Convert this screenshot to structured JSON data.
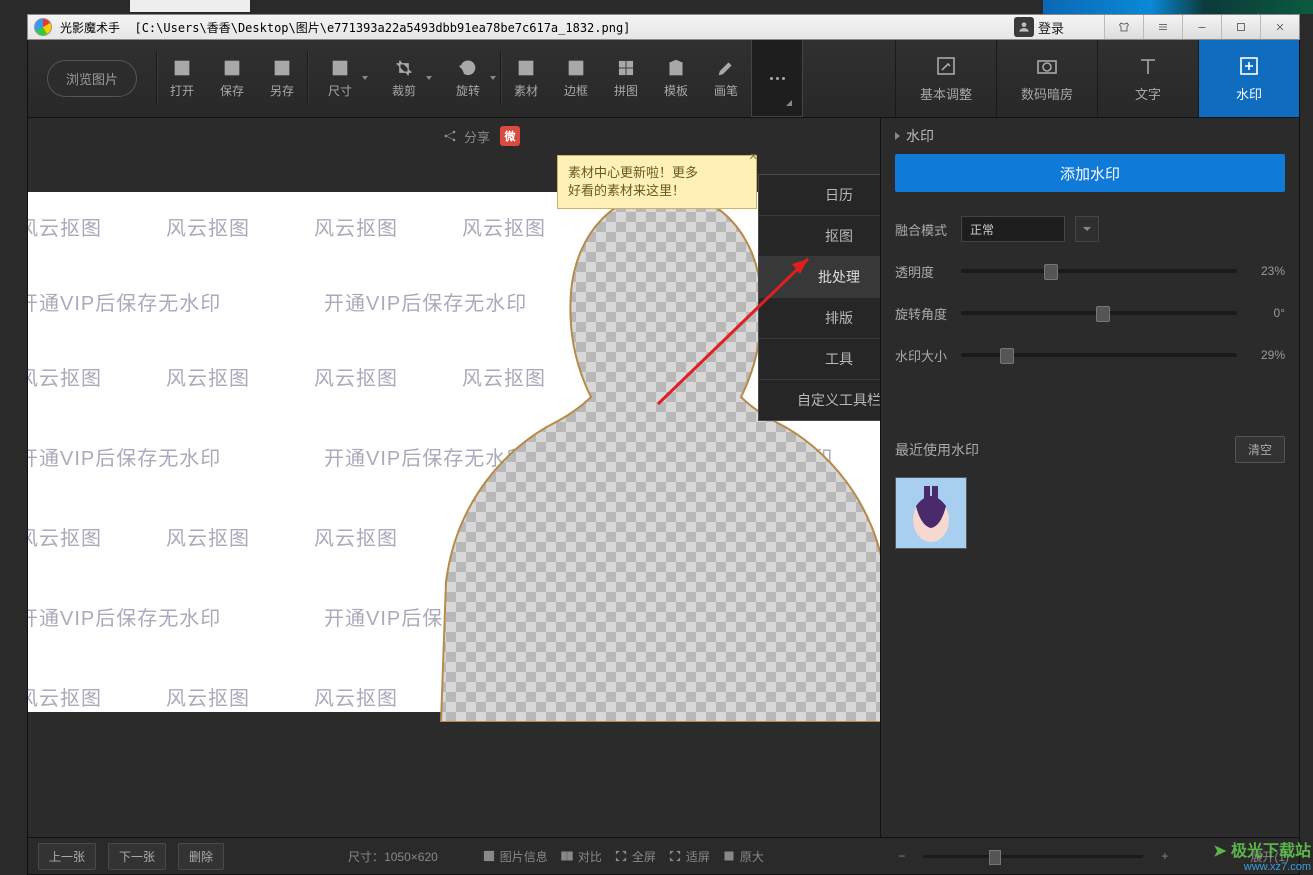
{
  "titlebar": {
    "app_name": "光影魔术手",
    "file_path": "[C:\\Users\\香香\\Desktop\\图片\\e771393a22a5493dbb91ea78be7c617a_1832.png]",
    "login": "登录"
  },
  "toolbar": {
    "browse": "浏览图片",
    "open": "打开",
    "save": "保存",
    "saveas": "另存",
    "size": "尺寸",
    "crop": "裁剪",
    "rotate": "旋转",
    "material": "素材",
    "border": "边框",
    "collage": "拼图",
    "template": "模板",
    "brush": "画笔",
    "tabs": {
      "basic": "基本调整",
      "darkroom": "数码暗房",
      "text": "文字",
      "watermark": "水印"
    }
  },
  "share_label": "分享",
  "tooltip": {
    "line1": "素材中心更新啦！更多",
    "line2": "好看的素材来这里！"
  },
  "dropdown": {
    "items": [
      "日历",
      "抠图",
      "批处理",
      "排版",
      "工具",
      "自定义工具栏"
    ]
  },
  "watermark_overlay": {
    "a": "风云抠图",
    "b": "开通VIP后保存无水印"
  },
  "side": {
    "title": "水印",
    "add": "添加水印",
    "blend_label": "融合模式",
    "blend_value": "正常",
    "opacity_label": "透明度",
    "opacity_value": "23%",
    "rotation_label": "旋转角度",
    "rotation_value": "0°",
    "size_label": "水印大小",
    "size_value": "29%",
    "recent_label": "最近使用水印",
    "clear": "清空"
  },
  "footer": {
    "prev": "上一张",
    "next": "下一张",
    "delete": "删除",
    "dim_label": "尺寸：",
    "dim_value": "1050×620",
    "info": "图片信息",
    "compare": "对比",
    "fullscreen": "全屏",
    "fit": "适屏",
    "orig": "原大",
    "expand": "展开(1)"
  },
  "corner": {
    "brand": "极光下载站",
    "url": "www.xz7.com"
  }
}
